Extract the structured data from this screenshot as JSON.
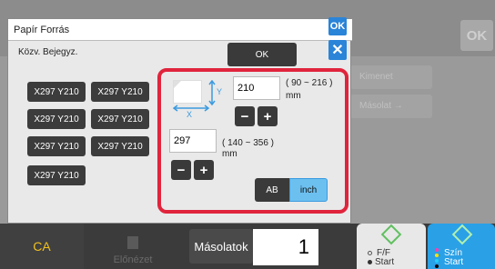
{
  "dialog": {
    "title": "Papír Forrás",
    "ok_corner": "OK",
    "close_icon": "close-icon",
    "subtitle": "Közv. Bejegyz.",
    "ok_button": "OK",
    "size_buttons": [
      "X297 Y210",
      "X297 Y210",
      "X297 Y210",
      "X297 Y210",
      "X297 Y210",
      "X297 Y210",
      "X297 Y210"
    ]
  },
  "custom_size": {
    "y_value": "210",
    "y_range": "( 90 ~ 216 )",
    "y_unit": "mm",
    "y_axis_label": "Y",
    "x_value": "297",
    "x_range": "( 140 ~ 356 )",
    "x_unit": "mm",
    "x_axis_label": "X",
    "minus": "−",
    "plus": "+",
    "unit_ab": "AB",
    "unit_inch": "inch",
    "selected_unit": "inch"
  },
  "background": {
    "ok": "OK",
    "row1": "Kimenet",
    "row2": "Másolat →"
  },
  "bottom_bar": {
    "ca": "CA",
    "preview": "Előnézet",
    "copies_label": "Másolatok",
    "copies_value": "1",
    "bw_start_line1": "F/F",
    "bw_start_line2": "Start",
    "color_start_line1": "Szín",
    "color_start_line2": "Start"
  },
  "colors": {
    "accent_blue": "#2a84d8",
    "highlight_red": "#e0243c",
    "color_start": "#2aa0e6",
    "ca_text": "#f0c020"
  }
}
